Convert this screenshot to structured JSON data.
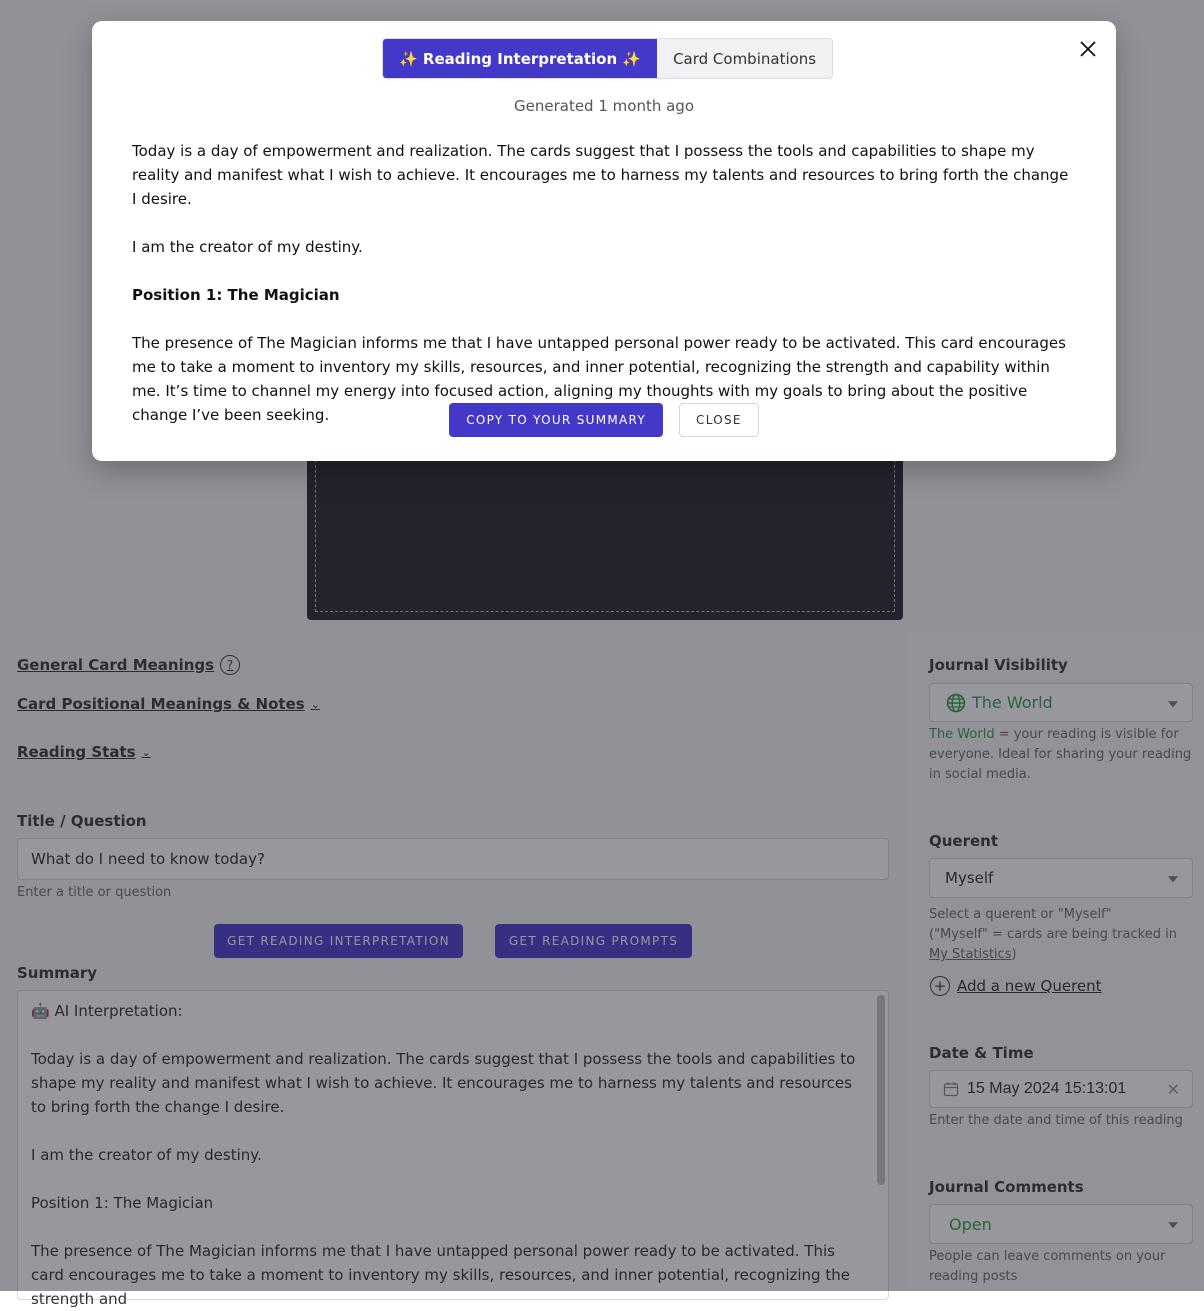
{
  "modal": {
    "tabs": [
      {
        "label": "✨ Reading Interpretation ✨",
        "active": true
      },
      {
        "label": "Card Combinations",
        "active": false
      }
    ],
    "generated": "Generated 1 month ago",
    "paragraphs": [
      "Today is a day of empowerment and realization. The cards suggest that I possess the tools and capabilities to shape my reality and manifest what I wish to achieve. It encourages me to harness my talents and resources to bring forth the change I desire.",
      "I am the creator of my destiny.",
      "Position 1: The Magician",
      "The presence of The Magician informs me that I have untapped personal power ready to be activated. This card encourages me to take a moment to inventory my skills, resources, and inner potential, recognizing the strength and capability within me. It’s time to channel my energy into focused action, aligning my thoughts with my goals to bring about the positive change I’ve been seeking."
    ],
    "copy_label": "COPY TO YOUR SUMMARY",
    "close_label": "CLOSE",
    "close_icon": "close-icon"
  },
  "page": {
    "links": {
      "general_meanings": "General Card Meanings",
      "positional_meanings": "Card Positional Meanings & Notes",
      "reading_stats": "Reading Stats"
    },
    "title_question": {
      "label": "Title / Question",
      "value": "What do I need to know today?",
      "help": "Enter a title or question"
    },
    "buttons": {
      "interpretation": "GET READING INTERPRETATION",
      "prompts": "GET READING PROMPTS"
    },
    "summary": {
      "label": "Summary",
      "header_icon": "🤖",
      "header": "AI Interpretation:",
      "paragraphs": [
        "Today is a day of empowerment and realization. The cards suggest that I possess the tools and capabilities to shape my reality and manifest what I wish to achieve. It encourages me to harness my talents and resources to bring forth the change I desire.",
        "I am the creator of my destiny.",
        "Position 1: The Magician",
        "The presence of The Magician informs me that I have untapped personal power ready to be activated. This card encourages me to take a moment to inventory my skills, resources, and inner potential, recognizing the strength and"
      ]
    },
    "sidebar": {
      "visibility": {
        "label": "Journal Visibility",
        "value": "The World",
        "help_highlight": "The World",
        "help_rest": " = your reading is visible for everyone. Ideal for sharing your reading in social media."
      },
      "querent": {
        "label": "Querent",
        "value": "Myself",
        "help_line1": "Select a querent or \"Myself\"",
        "help_line2_prefix": "(\"Myself\" = cards are being tracked in ",
        "help_link": "My Statistics",
        "help_line2_suffix": ")",
        "add_label": "Add a new Querent"
      },
      "datetime": {
        "label": "Date & Time",
        "value": "15 May 2024 15:13:01",
        "help": "Enter the date and time of this reading"
      },
      "comments": {
        "label": "Journal Comments",
        "value": "Open",
        "help": "People can leave comments on your reading posts"
      }
    }
  }
}
